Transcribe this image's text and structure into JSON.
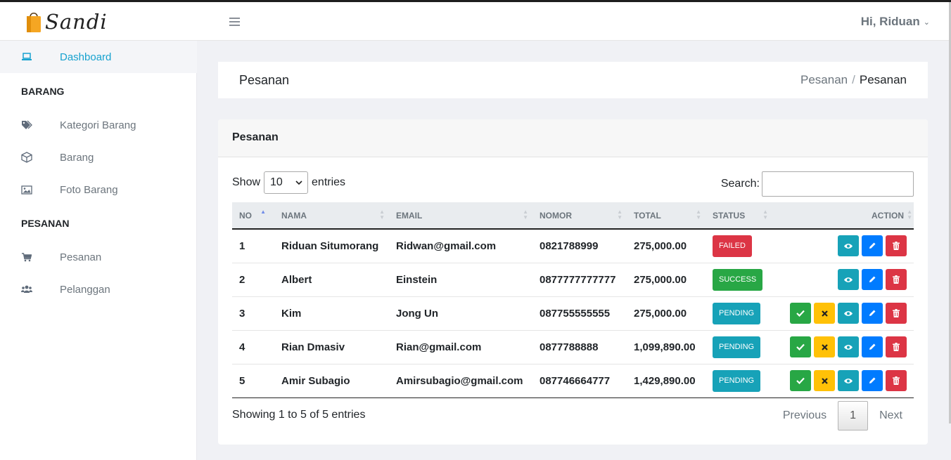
{
  "app": {
    "brand": "Sandi"
  },
  "header": {
    "user_greeting": "Hi, Riduan"
  },
  "sidebar": {
    "dashboard": "Dashboard",
    "section_barang": "BARANG",
    "kategori": "Kategori Barang",
    "barang": "Barang",
    "foto": "Foto Barang",
    "section_pesanan": "PESANAN",
    "pesanan": "Pesanan",
    "pelanggan": "Pelanggan"
  },
  "page": {
    "title": "Pesanan",
    "breadcrumb": [
      "Pesanan",
      "Pesanan"
    ]
  },
  "card": {
    "title": "Pesanan"
  },
  "table_controls": {
    "show_label": "Show",
    "entries_value": "10",
    "entries_label": "entries",
    "search_label": "Search:",
    "search_value": ""
  },
  "table": {
    "columns": [
      "NO",
      "NAMA",
      "EMAIL",
      "NOMOR",
      "TOTAL",
      "STATUS",
      "ACTION"
    ],
    "rows": [
      {
        "no": "1",
        "nama": "Riduan Situmorang",
        "email": "Ridwan@gmail.com",
        "nomor": "0821788999",
        "total": "275,000.00",
        "status": "FAILED"
      },
      {
        "no": "2",
        "nama": "Albert",
        "email": "Einstein",
        "nomor": "0877777777777",
        "total": "275,000.00",
        "status": "SUCCESS"
      },
      {
        "no": "3",
        "nama": "Kim",
        "email": "Jong Un",
        "nomor": "087755555555",
        "total": "275,000.00",
        "status": "PENDING"
      },
      {
        "no": "4",
        "nama": "Rian Dmasiv",
        "email": "Rian@gmail.com",
        "nomor": "0877788888",
        "total": "1,099,890.00",
        "status": "PENDING"
      },
      {
        "no": "5",
        "nama": "Amir Subagio",
        "email": "Amirsubagio@gmail.com",
        "nomor": "087746664777",
        "total": "1,429,890.00",
        "status": "PENDING"
      }
    ]
  },
  "footer": {
    "info": "Showing 1 to 5 of 5 entries",
    "previous": "Previous",
    "page": "1",
    "next": "Next"
  },
  "colors": {
    "failed": "#dc3545",
    "success": "#28a745",
    "pending": "#17a2b8",
    "approve": "#28a745",
    "reject": "#ffc107",
    "view": "#17a2b8",
    "edit": "#007bff",
    "delete": "#dc3545",
    "active_link": "#17a2cf"
  },
  "icons": {
    "dashboard": "laptop-icon",
    "kategori": "tags-icon",
    "barang": "box-icon",
    "foto": "image-icon",
    "pesanan": "cart-icon",
    "pelanggan": "users-icon"
  }
}
